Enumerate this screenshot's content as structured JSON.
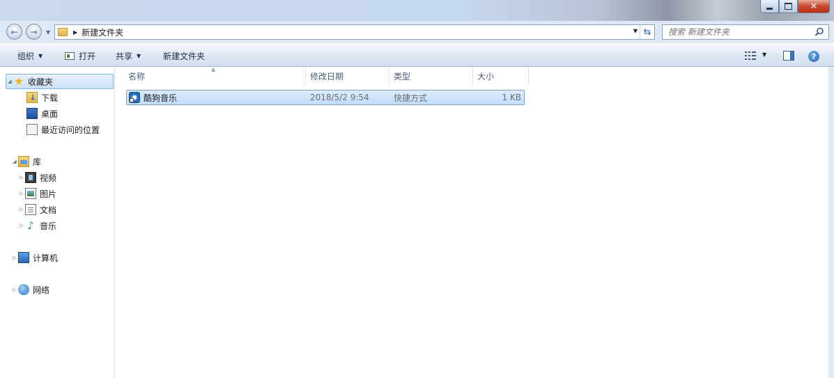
{
  "window": {
    "caption_buttons": {
      "minimize": "–",
      "maximize": "□",
      "close": "✕"
    }
  },
  "address": {
    "back_icon": "back-arrow-icon",
    "forward_icon": "forward-arrow-icon",
    "crumb": "新建文件夹",
    "refresh_icon": "refresh-icon"
  },
  "search": {
    "placeholder": "搜索 新建文件夹"
  },
  "toolbar": {
    "organize": "组织",
    "open": "打开",
    "share": "共享",
    "new_folder": "新建文件夹"
  },
  "nav": {
    "favorites": "收藏夹",
    "downloads": "下载",
    "desktop": "桌面",
    "recent": "最近访问的位置",
    "libraries": "库",
    "videos": "视频",
    "pictures": "图片",
    "documents": "文档",
    "music": "音乐",
    "computer": "计算机",
    "network": "网络"
  },
  "columns": {
    "name": "名称",
    "modified": "修改日期",
    "type": "类型",
    "size": "大小"
  },
  "files": [
    {
      "name": "酷狗音乐",
      "modified": "2018/5/2 9:54",
      "type": "快捷方式",
      "size": "1 KB",
      "selected": true
    }
  ],
  "colors": {
    "selection": "#cbe1fa",
    "toolbar": "#dfe8f4",
    "close": "#c9452c"
  }
}
